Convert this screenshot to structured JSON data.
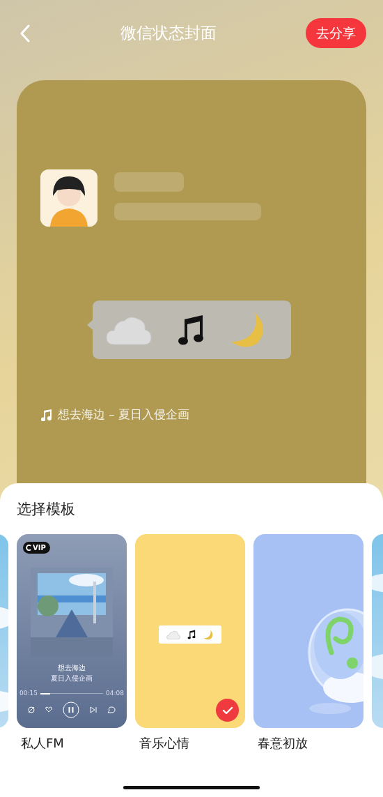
{
  "header": {
    "title": "微信状态封面",
    "share_button": "去分享"
  },
  "cover": {
    "song": "想去海边 – 夏日入侵企画"
  },
  "templates": {
    "title": "选择模板",
    "items": [
      {
        "kind": "sky"
      },
      {
        "kind": "player",
        "label": "私人FM",
        "selected": false,
        "badge": "VIP",
        "song": "想去海边",
        "artist": "夏日入侵企画",
        "elapsed": "00:15",
        "duration": "04:08",
        "level": 0.16
      },
      {
        "kind": "mood",
        "label": "音乐心情",
        "selected": true
      },
      {
        "kind": "glass",
        "label": "春意初放",
        "selected": false
      },
      {
        "kind": "sky"
      }
    ]
  }
}
